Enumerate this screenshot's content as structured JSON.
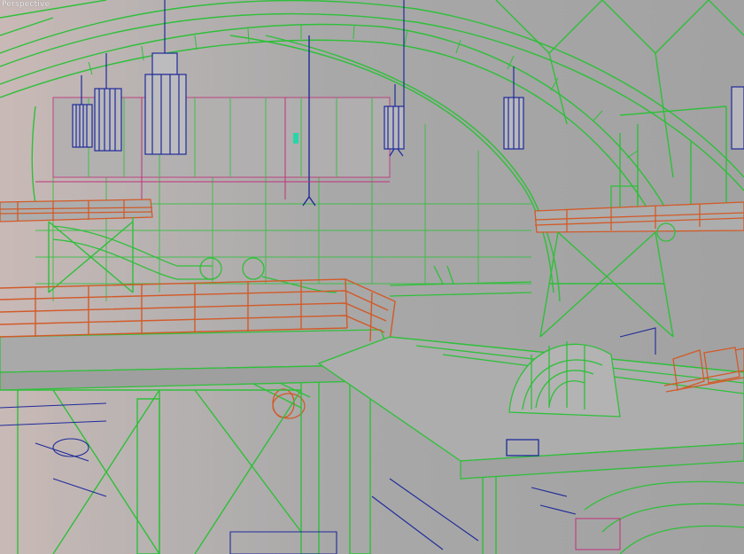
{
  "viewport": {
    "label": "Perspective",
    "mode": "wireframe-over-shaded",
    "colors": {
      "background": "#a5a5a5",
      "wire_structure": "#2fbf3a",
      "wire_detail": "#1f2a9a",
      "wire_railing": "#d25a28",
      "wire_pink": "#c0307a",
      "wire_cyan": "#27d6a6"
    }
  },
  "objects": [
    {
      "name": "dome-arch-frame",
      "color": "wire_structure"
    },
    {
      "name": "hanging-lamp-left-small",
      "color": "wire_detail"
    },
    {
      "name": "hanging-lamp-left-medium",
      "color": "wire_detail"
    },
    {
      "name": "hanging-lamp-left-large",
      "color": "wire_detail"
    },
    {
      "name": "hanging-lamp-center",
      "color": "wire_detail"
    },
    {
      "name": "hanging-lamp-right",
      "color": "wire_detail"
    },
    {
      "name": "catwalk-left",
      "color": "wire_railing"
    },
    {
      "name": "catwalk-right",
      "color": "wire_railing"
    },
    {
      "name": "main-walkway-railing",
      "color": "wire_railing"
    },
    {
      "name": "steel-truss-support",
      "color": "wire_structure"
    },
    {
      "name": "pipeline",
      "color": "wire_structure"
    },
    {
      "name": "turbine-housing",
      "color": "wire_structure"
    }
  ]
}
